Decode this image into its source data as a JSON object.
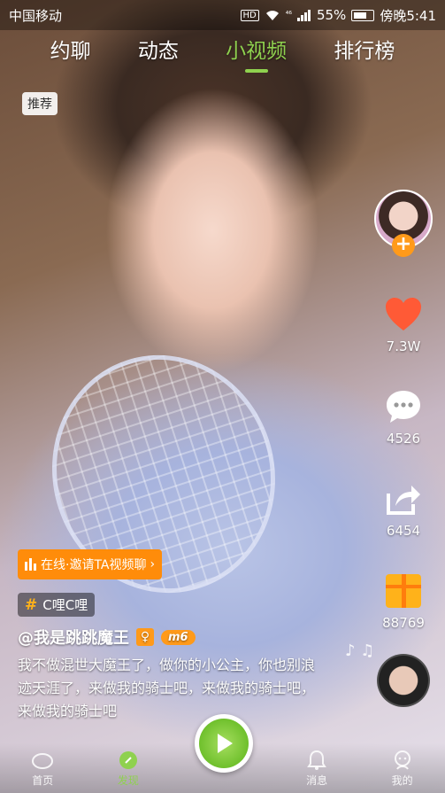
{
  "status_bar": {
    "carrier": "中国移动",
    "hd": "HD",
    "signal_label": "⁴⁶",
    "battery_percent": "55%",
    "time": "傍晚5:41"
  },
  "top_tabs": [
    {
      "label": "约聊"
    },
    {
      "label": "动态"
    },
    {
      "label": "小视频",
      "active": true
    },
    {
      "label": "排行榜"
    }
  ],
  "recommend_label": "推荐",
  "rail": {
    "like_count": "7.3W",
    "comment_count": "4526",
    "share_count": "6454",
    "gift_count": "88769",
    "follow_symbol": "+"
  },
  "online_button": {
    "label": "在线·邀请TA视频聊",
    "arrow": "›"
  },
  "topic": {
    "hash": "#",
    "label": "C哩C哩"
  },
  "user": {
    "handle": "@我是跳跳魔王",
    "gender_symbol": "♀",
    "level_label": "m6"
  },
  "description": "我不做混世大魔王了，做你的小公主，你也别浪迹天涯了，来做我的骑士吧，来做我的骑士吧，来做我的骑士吧",
  "music_notes": "♪ ♫",
  "bottom_nav": [
    {
      "label": "首页",
      "icon": "home-icon"
    },
    {
      "label": "发现",
      "icon": "discover-icon",
      "active": true
    },
    {
      "label": "",
      "icon": "play-icon"
    },
    {
      "label": "消息",
      "icon": "bell-icon"
    },
    {
      "label": "我的",
      "icon": "profile-icon"
    }
  ],
  "colors": {
    "accent_green": "#8fd14f",
    "accent_orange": "#ff9a1a",
    "like_red": "#ff5a36"
  }
}
